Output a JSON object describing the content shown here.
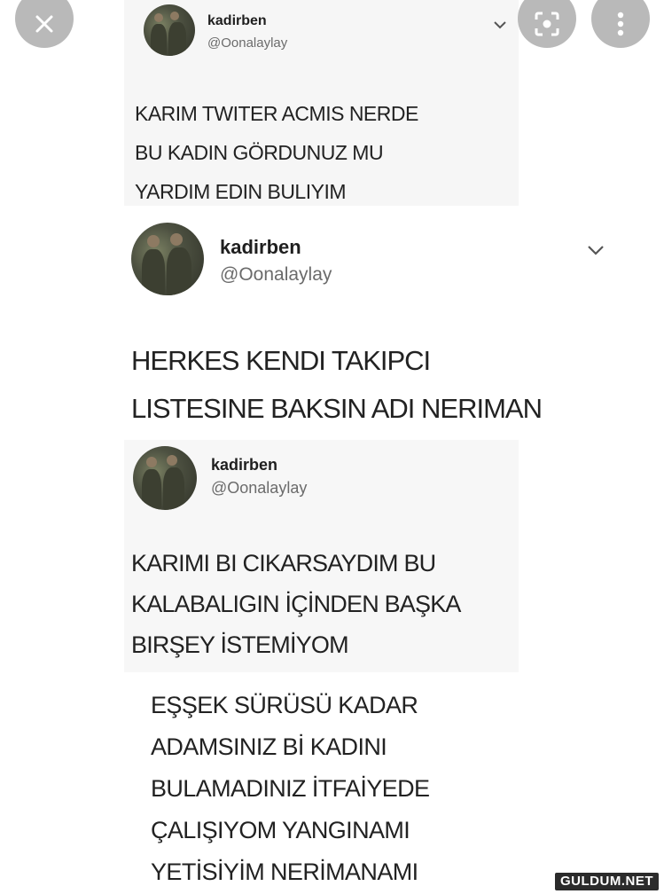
{
  "overlay": {
    "close_icon": "close-icon",
    "lens_icon": "lens-search-icon",
    "more_icon": "more-vertical-icon"
  },
  "tweets": [
    {
      "name": "kadirben",
      "handle": "@Oonalaylay",
      "lines": [
        "KARIM TWITER ACMIS NERDE",
        "BU KADIN GÖRDUNUZ MU",
        "YARDIM EDIN BULIYIM"
      ]
    },
    {
      "name": "kadirben",
      "handle": "@Oonalaylay",
      "lines": [
        "HERKES KENDI TAKIPCI",
        "LISTESINE BAKSIN ADI NERIMAN"
      ]
    },
    {
      "name": "kadirben",
      "handle": "@Oonalaylay",
      "lines": [
        "KARIMI BI CIKARSAYDIM BU",
        "KALABALIGIN İÇİNDEN BAŞKA",
        "BIRŞEY İSTEMİYOM"
      ]
    }
  ],
  "reply": {
    "lines": [
      "EŞŞEK SÜRÜSÜ KADAR",
      "ADAMSINIZ Bİ KADINI",
      "BULAMADINIZ İTFAİYEDE",
      "ÇALIŞIYOM YANGINAMI",
      "YETİSİYİM NERİMANAMI"
    ]
  },
  "watermark": "GULDUM.NET"
}
